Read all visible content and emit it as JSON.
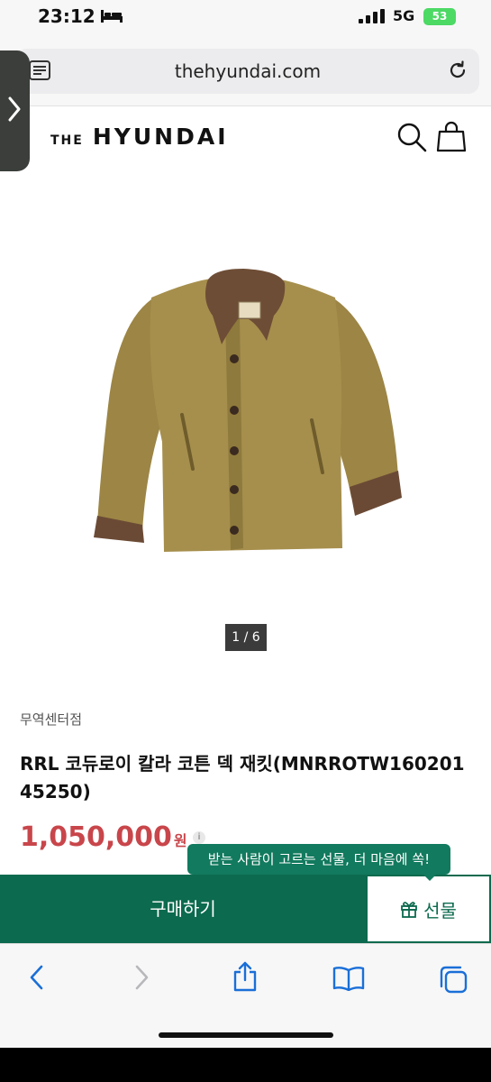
{
  "status_bar": {
    "time": "23:12",
    "network": "5G",
    "battery": "53"
  },
  "browser": {
    "url": "thehyundai.com"
  },
  "site": {
    "logo_small": "THE",
    "logo_big": "HYUNDAI"
  },
  "product": {
    "image_counter": "1 / 6",
    "store": "무역센터점",
    "title": "RRL 코듀로이 칼라 코튼 덱 재킷(MNRROTW16020145250)",
    "price": "1,050,000",
    "price_unit": "원",
    "info_symbol": "i"
  },
  "tooltip": {
    "text": "받는 사람이 고르는 선물, 더 마음에 쏙!"
  },
  "actions": {
    "buy_label": "구매하기",
    "gift_label": "선물"
  },
  "colors": {
    "brand_green": "#0c6a4e",
    "tooltip_green": "#127a5e",
    "price_red": "#c8464b"
  }
}
